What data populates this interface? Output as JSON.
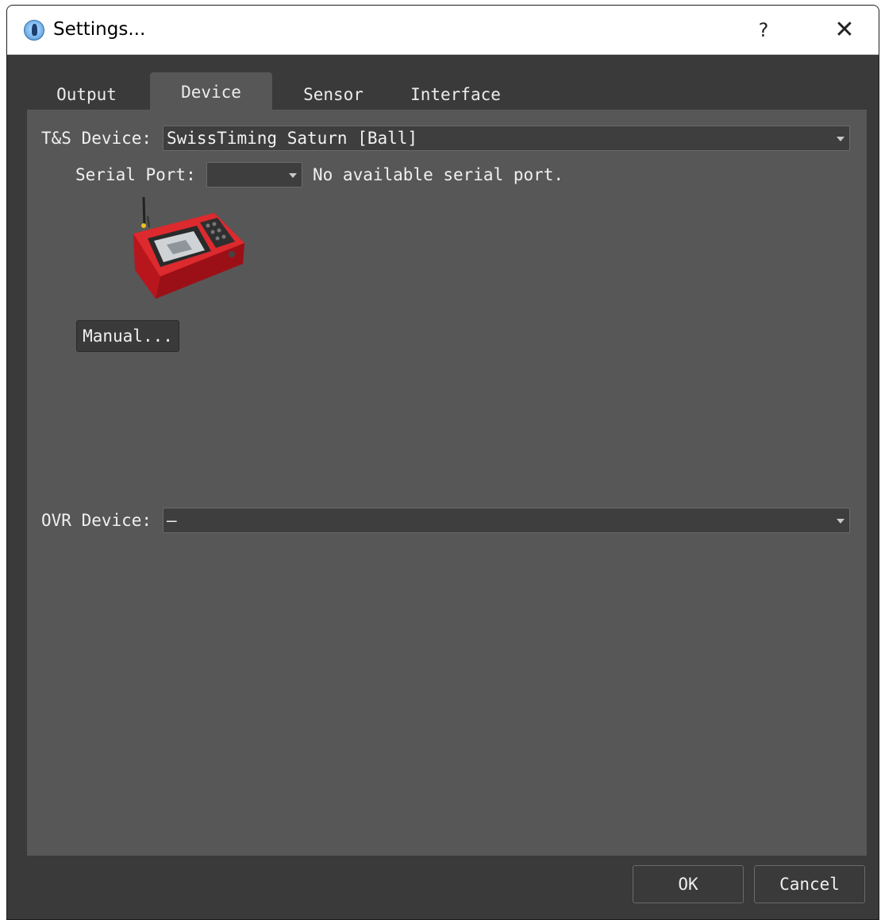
{
  "window": {
    "title": "Settings...",
    "help_glyph": "?",
    "close_glyph": "✕"
  },
  "tabs": [
    {
      "label": "Output",
      "active": false
    },
    {
      "label": "Device",
      "active": true
    },
    {
      "label": "Sensor",
      "active": false
    },
    {
      "label": "Interface",
      "active": false
    }
  ],
  "device_panel": {
    "ts_device_label": "T&S Device:",
    "ts_device_value": "SwissTiming Saturn [Ball]",
    "serial_port_label": "Serial Port:",
    "serial_port_value": "",
    "serial_port_status": "No available serial port.",
    "manual_button": "Manual...",
    "ovr_device_label": "OVR Device:",
    "ovr_device_value": "–"
  },
  "footer": {
    "ok": "OK",
    "cancel": "Cancel"
  },
  "icons": {
    "app": "app-icon",
    "dropdown": "chevron-down-icon",
    "device_image": "timing-device-image"
  },
  "colors": {
    "window_bg": "#3a3a3a",
    "panel_bg": "#575757",
    "field_bg": "#3e3e3e",
    "device_red": "#d81f26"
  }
}
